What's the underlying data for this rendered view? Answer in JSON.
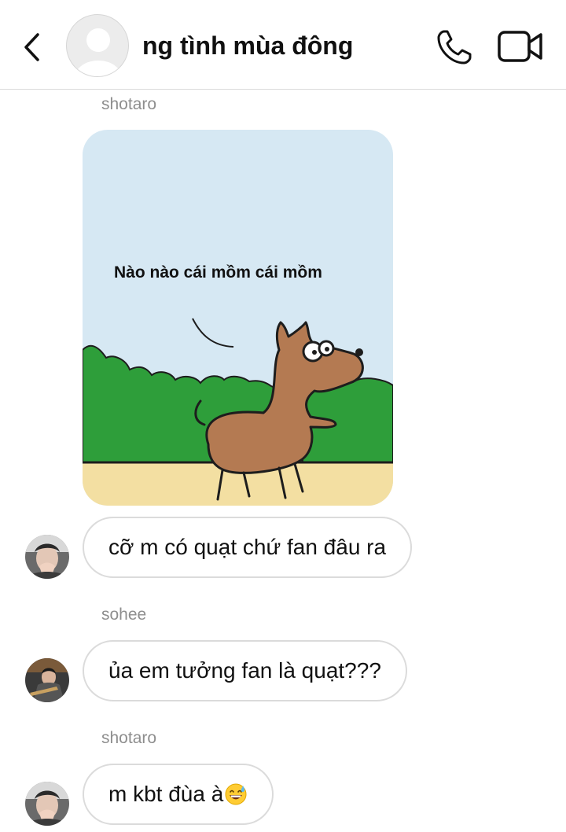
{
  "header": {
    "title": "ng tình mùa đông",
    "back_icon": "chevron-left-icon",
    "call_icon": "phone-icon",
    "video_icon": "video-camera-icon"
  },
  "messages": [
    {
      "sender": "shotaro",
      "type": "image",
      "caption": "Nào nào cái mồm cái mồm"
    },
    {
      "sender": "shotaro",
      "type": "text",
      "text": "cỡ m có quạt chứ fan đâu ra"
    },
    {
      "sender": "sohee",
      "type": "text",
      "text": "ủa em tưởng fan là quạt???"
    },
    {
      "sender": "shotaro",
      "type": "text",
      "text": "m kbt đùa à",
      "emoji": "grinning-sweat-emoji"
    }
  ],
  "colors": {
    "sky": "#d6e8f3",
    "bushes": "#2e9e3a",
    "ground": "#f3dfa2",
    "dog": "#b47a52",
    "bubble_border": "#dbdbdb",
    "sender_text": "#8e8e8e"
  }
}
